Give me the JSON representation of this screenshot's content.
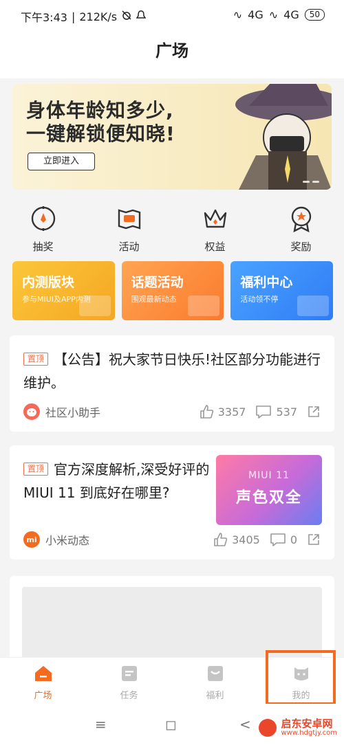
{
  "status": {
    "time": "下午3:43",
    "speed": "212K/s",
    "net1": "4G",
    "net2": "4G",
    "battery": "50"
  },
  "header": {
    "title": "广场"
  },
  "banner": {
    "line1": "身体年龄知多少,",
    "line2": "一键解锁便知晓!",
    "cta": "立即进入"
  },
  "quick": [
    {
      "label": "抽奖",
      "icon": "lottery-icon"
    },
    {
      "label": "活动",
      "icon": "activity-icon"
    },
    {
      "label": "权益",
      "icon": "crown-icon"
    },
    {
      "label": "奖励",
      "icon": "medal-icon"
    }
  ],
  "cards": [
    {
      "title": "内测版块",
      "sub": "参与MIUI及APP内测"
    },
    {
      "title": "话题活动",
      "sub": "围观最新动态"
    },
    {
      "title": "福利中心",
      "sub": "活动领不停"
    }
  ],
  "posts": [
    {
      "tag": "置顶",
      "title": "【公告】祝大家节日快乐!社区部分功能进行维护。",
      "author": "社区小助手",
      "likes": "3357",
      "comments": "537"
    },
    {
      "tag": "置顶",
      "title": "官方深度解析,深受好评的 MIUI 11 到底好在哪里?",
      "author": "小米动态",
      "likes": "3405",
      "comments": "0",
      "thumb_line1": "MIUI 11",
      "thumb_line2": "声色双全"
    }
  ],
  "tabs": [
    {
      "label": "广场",
      "active": true
    },
    {
      "label": "任务",
      "active": false
    },
    {
      "label": "福利",
      "active": false
    },
    {
      "label": "我的",
      "active": false
    }
  ],
  "navbar": {
    "menu": "≡",
    "home": "◻",
    "back": "<"
  },
  "watermark": {
    "name": "启东安卓网",
    "url": "www.hdgtjy.com"
  },
  "colors": {
    "accent": "#f36a21",
    "pin": "#e8734a"
  }
}
